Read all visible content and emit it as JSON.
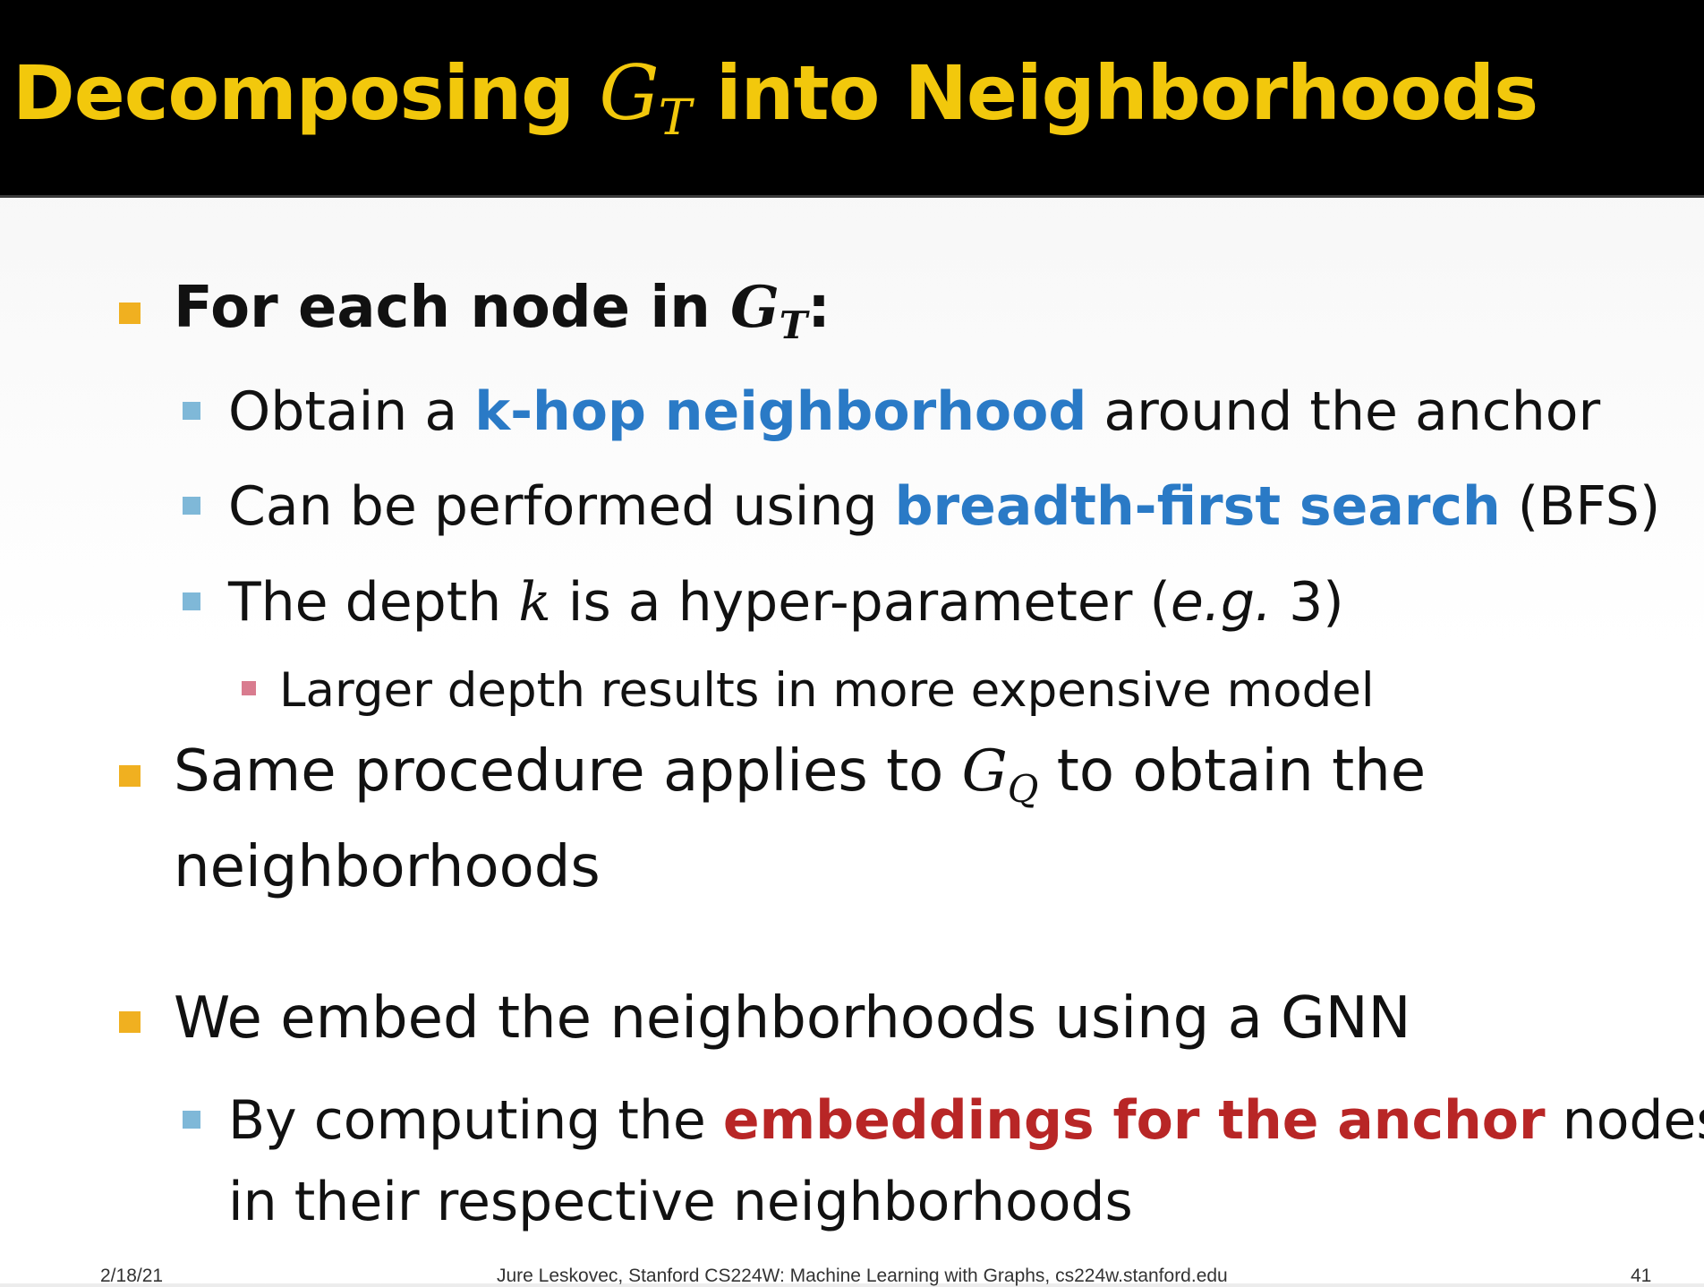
{
  "title": {
    "prefix": "Decomposing ",
    "math_main": "G",
    "math_sub": "T",
    "suffix": " into Neighborhoods"
  },
  "bullets": {
    "b1": {
      "prefix": "For each node in ",
      "math_main": "G",
      "math_sub": "T",
      "suffix": ":"
    },
    "b1_1": {
      "prefix": "Obtain a ",
      "highlight": "k-hop neighborhood",
      "suffix": " around the anchor"
    },
    "b1_2": {
      "prefix": "Can be performed using ",
      "highlight": "breadth-first search",
      "suffix": " (BFS)"
    },
    "b1_3": {
      "prefix": "The depth ",
      "math": "k",
      "middle": " is a hyper-parameter (",
      "italic": "e.g.",
      "suffix": " 3)"
    },
    "b1_3_1": {
      "text": "Larger depth results in more expensive model"
    },
    "b2": {
      "prefix": "Same procedure applies to ",
      "math_main": "G",
      "math_sub": "Q",
      "suffix": " to obtain the",
      "line2": "neighborhoods"
    },
    "b3": {
      "text": "We embed the neighborhoods using a GNN"
    },
    "b3_1": {
      "prefix": "By computing the ",
      "highlight": "embeddings for the anchor",
      "suffix": " nodes",
      "line2": "in their respective neighborhoods"
    }
  },
  "footer": {
    "date": "2/18/21",
    "credit": "Jure Leskovec, Stanford CS224W: Machine Learning with Graphs, cs224w.stanford.edu",
    "page": "41"
  },
  "colors": {
    "title": "#f2c80c",
    "bullet_level1": "#f0b020",
    "bullet_level2": "#7fb8d8",
    "bullet_level3": "#d97c8f",
    "highlight_blue": "#2a7ac6",
    "highlight_red": "#b82626"
  }
}
